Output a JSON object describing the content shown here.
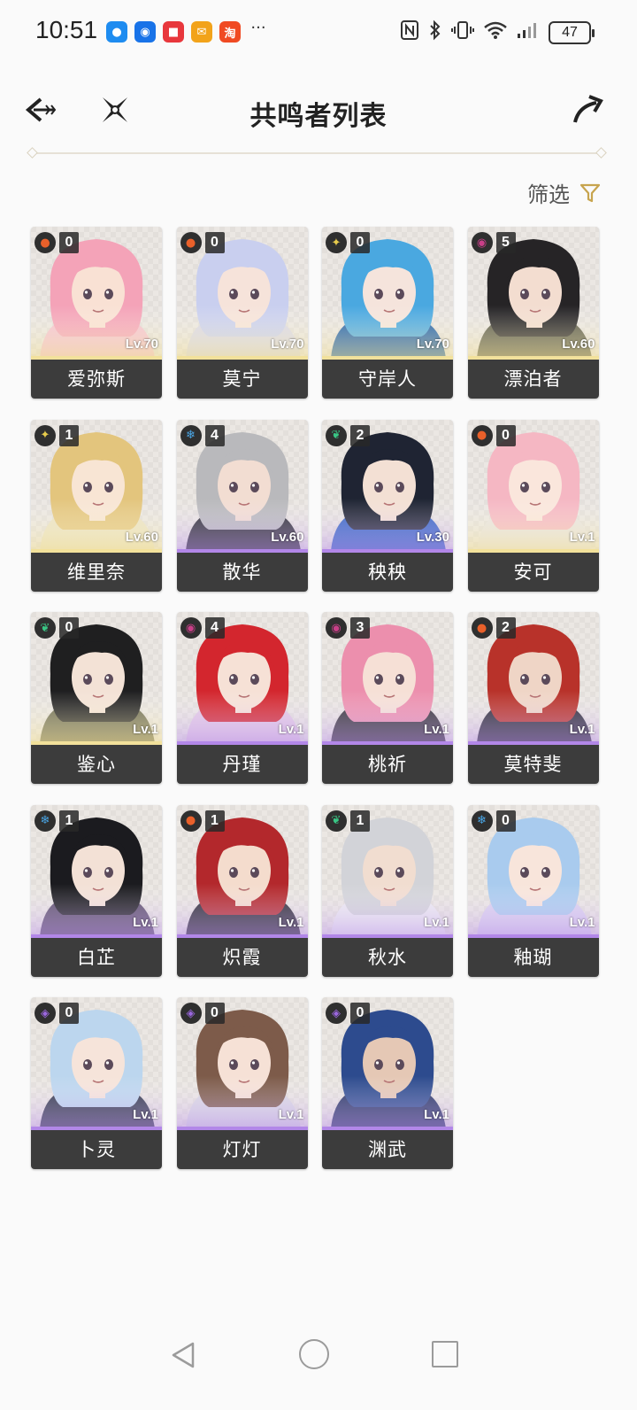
{
  "status_bar": {
    "time": "10:51",
    "app_icons": [
      {
        "name": "messages-icon",
        "color": "#1e8cf0",
        "glyph": "●"
      },
      {
        "name": "bulb-icon",
        "color": "#1873e8",
        "glyph": "◉"
      },
      {
        "name": "red-app-icon",
        "color": "#e8373c",
        "glyph": "■"
      },
      {
        "name": "mail-icon",
        "color": "#f2a31a",
        "glyph": "✉"
      },
      {
        "name": "taobao-icon",
        "color": "#f04a22",
        "glyph": "淘"
      }
    ],
    "more": "···",
    "battery": "47"
  },
  "header": {
    "title": "共鸣者列表"
  },
  "filter": {
    "label": "筛选"
  },
  "colors": {
    "accent": "#c7a44e",
    "name_bar": "#3c3c3c",
    "gold_stripe": "#f2e19b",
    "purple_stripe": "#b287e8"
  },
  "characters": [
    {
      "name": "爱弥斯",
      "level": "Lv.70",
      "const": "0",
      "element": "fusion",
      "rarity": "gold",
      "hair": "#f4a3b8",
      "skin": "#f9e1d4",
      "cloth": "#f4c1d0"
    },
    {
      "name": "莫宁",
      "level": "Lv.70",
      "const": "0",
      "element": "fusion",
      "rarity": "gold",
      "hair": "#c9cfef",
      "skin": "#f6e3da",
      "cloth": "#d8d7e6"
    },
    {
      "name": "守岸人",
      "level": "Lv.70",
      "const": "0",
      "element": "spectro",
      "rarity": "gold",
      "hair": "#4aa8e0",
      "skin": "#f5e4dc",
      "cloth": "#1f5fa8"
    },
    {
      "name": "漂泊者",
      "level": "Lv.60",
      "const": "5",
      "element": "havoc",
      "rarity": "gold",
      "hair": "#262426",
      "skin": "#f3ddd0",
      "cloth": "#5a5a48"
    },
    {
      "name": "维里奈",
      "level": "Lv.60",
      "const": "1",
      "element": "spectro",
      "rarity": "gold",
      "hair": "#e3c57d",
      "skin": "#f8e5d4",
      "cloth": "#eae2c4"
    },
    {
      "name": "散华",
      "level": "Lv.60",
      "const": "4",
      "element": "glacio",
      "rarity": "purple",
      "hair": "#b9b9bc",
      "skin": "#f2ddd2",
      "cloth": "#2c2c34"
    },
    {
      "name": "秧秧",
      "level": "Lv.30",
      "const": "2",
      "element": "aero",
      "rarity": "purple",
      "hair": "#1f2433",
      "skin": "#f3e0d4",
      "cloth": "#3564c4"
    },
    {
      "name": "安可",
      "level": "Lv.1",
      "const": "0",
      "element": "fusion",
      "rarity": "gold",
      "hair": "#f5b7c3",
      "skin": "#fae6dc",
      "cloth": "#e7e3e1"
    },
    {
      "name": "鉴心",
      "level": "Lv.1",
      "const": "0",
      "element": "aero",
      "rarity": "gold",
      "hair": "#1f1f20",
      "skin": "#f3e2d6",
      "cloth": "#6b6a50"
    },
    {
      "name": "丹瑾",
      "level": "Lv.1",
      "const": "4",
      "element": "havoc",
      "rarity": "purple",
      "hair": "#d3262e",
      "skin": "#f6e1d6",
      "cloth": "#e1c7e4"
    },
    {
      "name": "桃祈",
      "level": "Lv.1",
      "const": "3",
      "element": "havoc",
      "rarity": "purple",
      "hair": "#ec8fad",
      "skin": "#f6e0d6",
      "cloth": "#333036"
    },
    {
      "name": "莫特斐",
      "level": "Lv.1",
      "const": "2",
      "element": "fusion",
      "rarity": "purple",
      "hair": "#b8322a",
      "skin": "#efd5c6",
      "cloth": "#2a2a36"
    },
    {
      "name": "白芷",
      "level": "Lv.1",
      "const": "1",
      "element": "glacio",
      "rarity": "purple",
      "hair": "#1b1b1f",
      "skin": "#f3e1d6",
      "cloth": "#5a4c6a"
    },
    {
      "name": "炽霞",
      "level": "Lv.1",
      "const": "1",
      "element": "fusion",
      "rarity": "purple",
      "hair": "#b3282c",
      "skin": "#f4dccd",
      "cloth": "#2b2a34"
    },
    {
      "name": "秋水",
      "level": "Lv.1",
      "const": "1",
      "element": "aero",
      "rarity": "purple",
      "hair": "#d2d3d8",
      "skin": "#f1ddd0",
      "cloth": "#ebe9f0"
    },
    {
      "name": "釉瑚",
      "level": "Lv.1",
      "const": "0",
      "element": "glacio",
      "rarity": "purple",
      "hair": "#a9cbee",
      "skin": "#f8e5db",
      "cloth": "#d9cfee"
    },
    {
      "name": "卜灵",
      "level": "Lv.1",
      "const": "0",
      "element": "electro",
      "rarity": "purple",
      "hair": "#bcd6ee",
      "skin": "#f6e4da",
      "cloth": "#2e3548"
    },
    {
      "name": "灯灯",
      "level": "Lv.1",
      "const": "0",
      "element": "electro",
      "rarity": "purple",
      "hair": "#7d5b4a",
      "skin": "#f6e1d6",
      "cloth": "#d8d6e2"
    },
    {
      "name": "渊武",
      "level": "Lv.1",
      "const": "0",
      "element": "electro",
      "rarity": "purple",
      "hair": "#2d4b8e",
      "skin": "#e5c8b5",
      "cloth": "#263363"
    }
  ],
  "element_icons": {
    "fusion": {
      "glyph": "●",
      "color": "#e9602a"
    },
    "spectro": {
      "glyph": "✦",
      "color": "#e7cb4c"
    },
    "havoc": {
      "glyph": "◉",
      "color": "#c93f88"
    },
    "glacio": {
      "glyph": "❄",
      "color": "#4aa6e6"
    },
    "aero": {
      "glyph": "❦",
      "color": "#39c584"
    },
    "electro": {
      "glyph": "◈",
      "color": "#9b67e0"
    }
  }
}
